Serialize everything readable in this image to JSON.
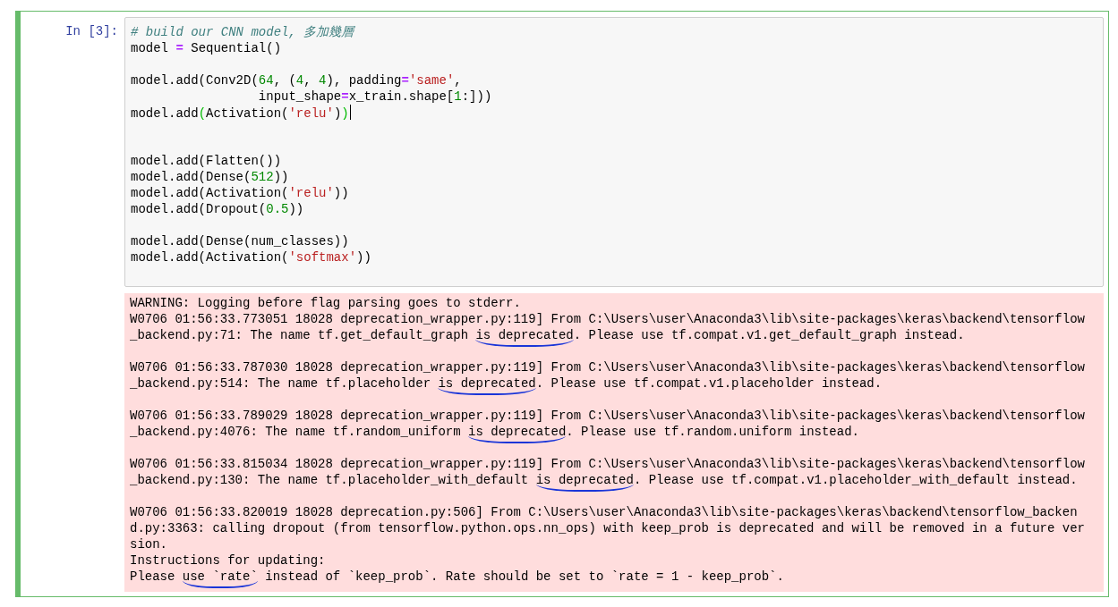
{
  "cell": {
    "prompt": "In [3]:",
    "selected": true,
    "code": [
      {
        "kind": "code",
        "cursor": false,
        "tokens": [
          {
            "text": "# build our CNN model, 多加幾層",
            "kind": "comment"
          }
        ]
      },
      {
        "kind": "code",
        "cursor": false,
        "tokens": [
          {
            "text": "model ",
            "kind": "plain"
          },
          {
            "text": "=",
            "kind": "operator"
          },
          {
            "text": " Sequential()",
            "kind": "plain"
          }
        ]
      },
      {
        "kind": "blank"
      },
      {
        "kind": "code",
        "cursor": false,
        "tokens": [
          {
            "text": "model.add(Conv2D(",
            "kind": "plain"
          },
          {
            "text": "64",
            "kind": "number"
          },
          {
            "text": ", (",
            "kind": "plain"
          },
          {
            "text": "4",
            "kind": "number"
          },
          {
            "text": ", ",
            "kind": "plain"
          },
          {
            "text": "4",
            "kind": "number"
          },
          {
            "text": "), padding",
            "kind": "plain"
          },
          {
            "text": "=",
            "kind": "operator"
          },
          {
            "text": "'same'",
            "kind": "string"
          },
          {
            "text": ",",
            "kind": "plain"
          }
        ]
      },
      {
        "kind": "code",
        "cursor": false,
        "tokens": [
          {
            "text": "                 input_shape",
            "kind": "plain"
          },
          {
            "text": "=",
            "kind": "operator"
          },
          {
            "text": "x_train.shape[",
            "kind": "plain"
          },
          {
            "text": "1",
            "kind": "number"
          },
          {
            "text": ":]))",
            "kind": "plain"
          }
        ]
      },
      {
        "kind": "code",
        "cursor": true,
        "tokens": [
          {
            "text": "model.add",
            "kind": "plain"
          },
          {
            "text": "(",
            "kind": "bracket"
          },
          {
            "text": "Activation(",
            "kind": "plain"
          },
          {
            "text": "'relu'",
            "kind": "string"
          },
          {
            "text": ")",
            "kind": "plain"
          },
          {
            "text": ")",
            "kind": "bracket"
          }
        ]
      },
      {
        "kind": "blank"
      },
      {
        "kind": "blank"
      },
      {
        "kind": "code",
        "cursor": false,
        "tokens": [
          {
            "text": "model.add(Flatten())",
            "kind": "plain"
          }
        ]
      },
      {
        "kind": "code",
        "cursor": false,
        "tokens": [
          {
            "text": "model.add(Dense(",
            "kind": "plain"
          },
          {
            "text": "512",
            "kind": "number"
          },
          {
            "text": "))",
            "kind": "plain"
          }
        ]
      },
      {
        "kind": "code",
        "cursor": false,
        "tokens": [
          {
            "text": "model.add(Activation(",
            "kind": "plain"
          },
          {
            "text": "'relu'",
            "kind": "string"
          },
          {
            "text": "))",
            "kind": "plain"
          }
        ]
      },
      {
        "kind": "code",
        "cursor": false,
        "tokens": [
          {
            "text": "model.add(Dropout(",
            "kind": "plain"
          },
          {
            "text": "0.5",
            "kind": "number"
          },
          {
            "text": "))",
            "kind": "plain"
          }
        ]
      },
      {
        "kind": "blank"
      },
      {
        "kind": "code",
        "cursor": false,
        "tokens": [
          {
            "text": "model.add(Dense(num_classes))",
            "kind": "plain"
          }
        ]
      },
      {
        "kind": "code",
        "cursor": false,
        "tokens": [
          {
            "text": "model.add(Activation(",
            "kind": "plain"
          },
          {
            "text": "'softmax'",
            "kind": "string"
          },
          {
            "text": "))",
            "kind": "plain"
          }
        ]
      }
    ],
    "output": {
      "kind": "stderr",
      "blocks": [
        [
          [
            {
              "text": "WARNING: Logging before flag parsing goes to stderr.",
              "marked": false
            }
          ],
          [
            {
              "text": "W0706 01:56:33.773051 18028 deprecation_wrapper.py:119] From C:\\Users\\user\\Anaconda3\\lib\\site-packages\\keras\\backend\\tensorflow",
              "marked": false
            }
          ],
          [
            {
              "text": "_backend.py:71: The name tf.get_default_graph ",
              "marked": false
            },
            {
              "text": "is deprecated",
              "marked": true
            },
            {
              "text": ". Please use tf.compat.v1.get_default_graph instead.",
              "marked": false
            }
          ]
        ],
        [
          [
            {
              "text": "W0706 01:56:33.787030 18028 deprecation_wrapper.py:119] From C:\\Users\\user\\Anaconda3\\lib\\site-packages\\keras\\backend\\tensorflow",
              "marked": false
            }
          ],
          [
            {
              "text": "_backend.py:514: The name tf.placeholder ",
              "marked": false
            },
            {
              "text": "is deprecated",
              "marked": true
            },
            {
              "text": ". Please use tf.compat.v1.placeholder instead.",
              "marked": false
            }
          ]
        ],
        [
          [
            {
              "text": "W0706 01:56:33.789029 18028 deprecation_wrapper.py:119] From C:\\Users\\user\\Anaconda3\\lib\\site-packages\\keras\\backend\\tensorflow",
              "marked": false
            }
          ],
          [
            {
              "text": "_backend.py:4076: The name tf.random_uniform ",
              "marked": false
            },
            {
              "text": "is deprecated",
              "marked": true
            },
            {
              "text": ". Please use tf.random.uniform instead.",
              "marked": false
            }
          ]
        ],
        [
          [
            {
              "text": "W0706 01:56:33.815034 18028 deprecation_wrapper.py:119] From C:\\Users\\user\\Anaconda3\\lib\\site-packages\\keras\\backend\\tensorflow",
              "marked": false
            }
          ],
          [
            {
              "text": "_backend.py:130: The name tf.placeholder_with_default ",
              "marked": false
            },
            {
              "text": "is deprecated",
              "marked": true
            },
            {
              "text": ". Please use tf.compat.v1.placeholder_with_default instead.",
              "marked": false
            }
          ]
        ],
        [
          [
            {
              "text": "W0706 01:56:33.820019 18028 deprecation.py:506] From C:\\Users\\user\\Anaconda3\\lib\\site-packages\\keras\\backend\\tensorflow_backen",
              "marked": false
            }
          ],
          [
            {
              "text": "d.py:3363: calling dropout (from tensorflow.python.ops.nn_ops) with keep_prob is deprecated and will be removed in a future ver",
              "marked": false
            }
          ],
          [
            {
              "text": "sion.",
              "marked": false
            }
          ],
          [
            {
              "text": "Instructions for updating:",
              "marked": false
            }
          ],
          [
            {
              "text": "Please ",
              "marked": false
            },
            {
              "text": "use `rate`",
              "marked": true
            },
            {
              "text": " instead of `keep_prob`. Rate should be set to `rate = 1 - keep_prob`.",
              "marked": false
            }
          ]
        ]
      ]
    }
  }
}
